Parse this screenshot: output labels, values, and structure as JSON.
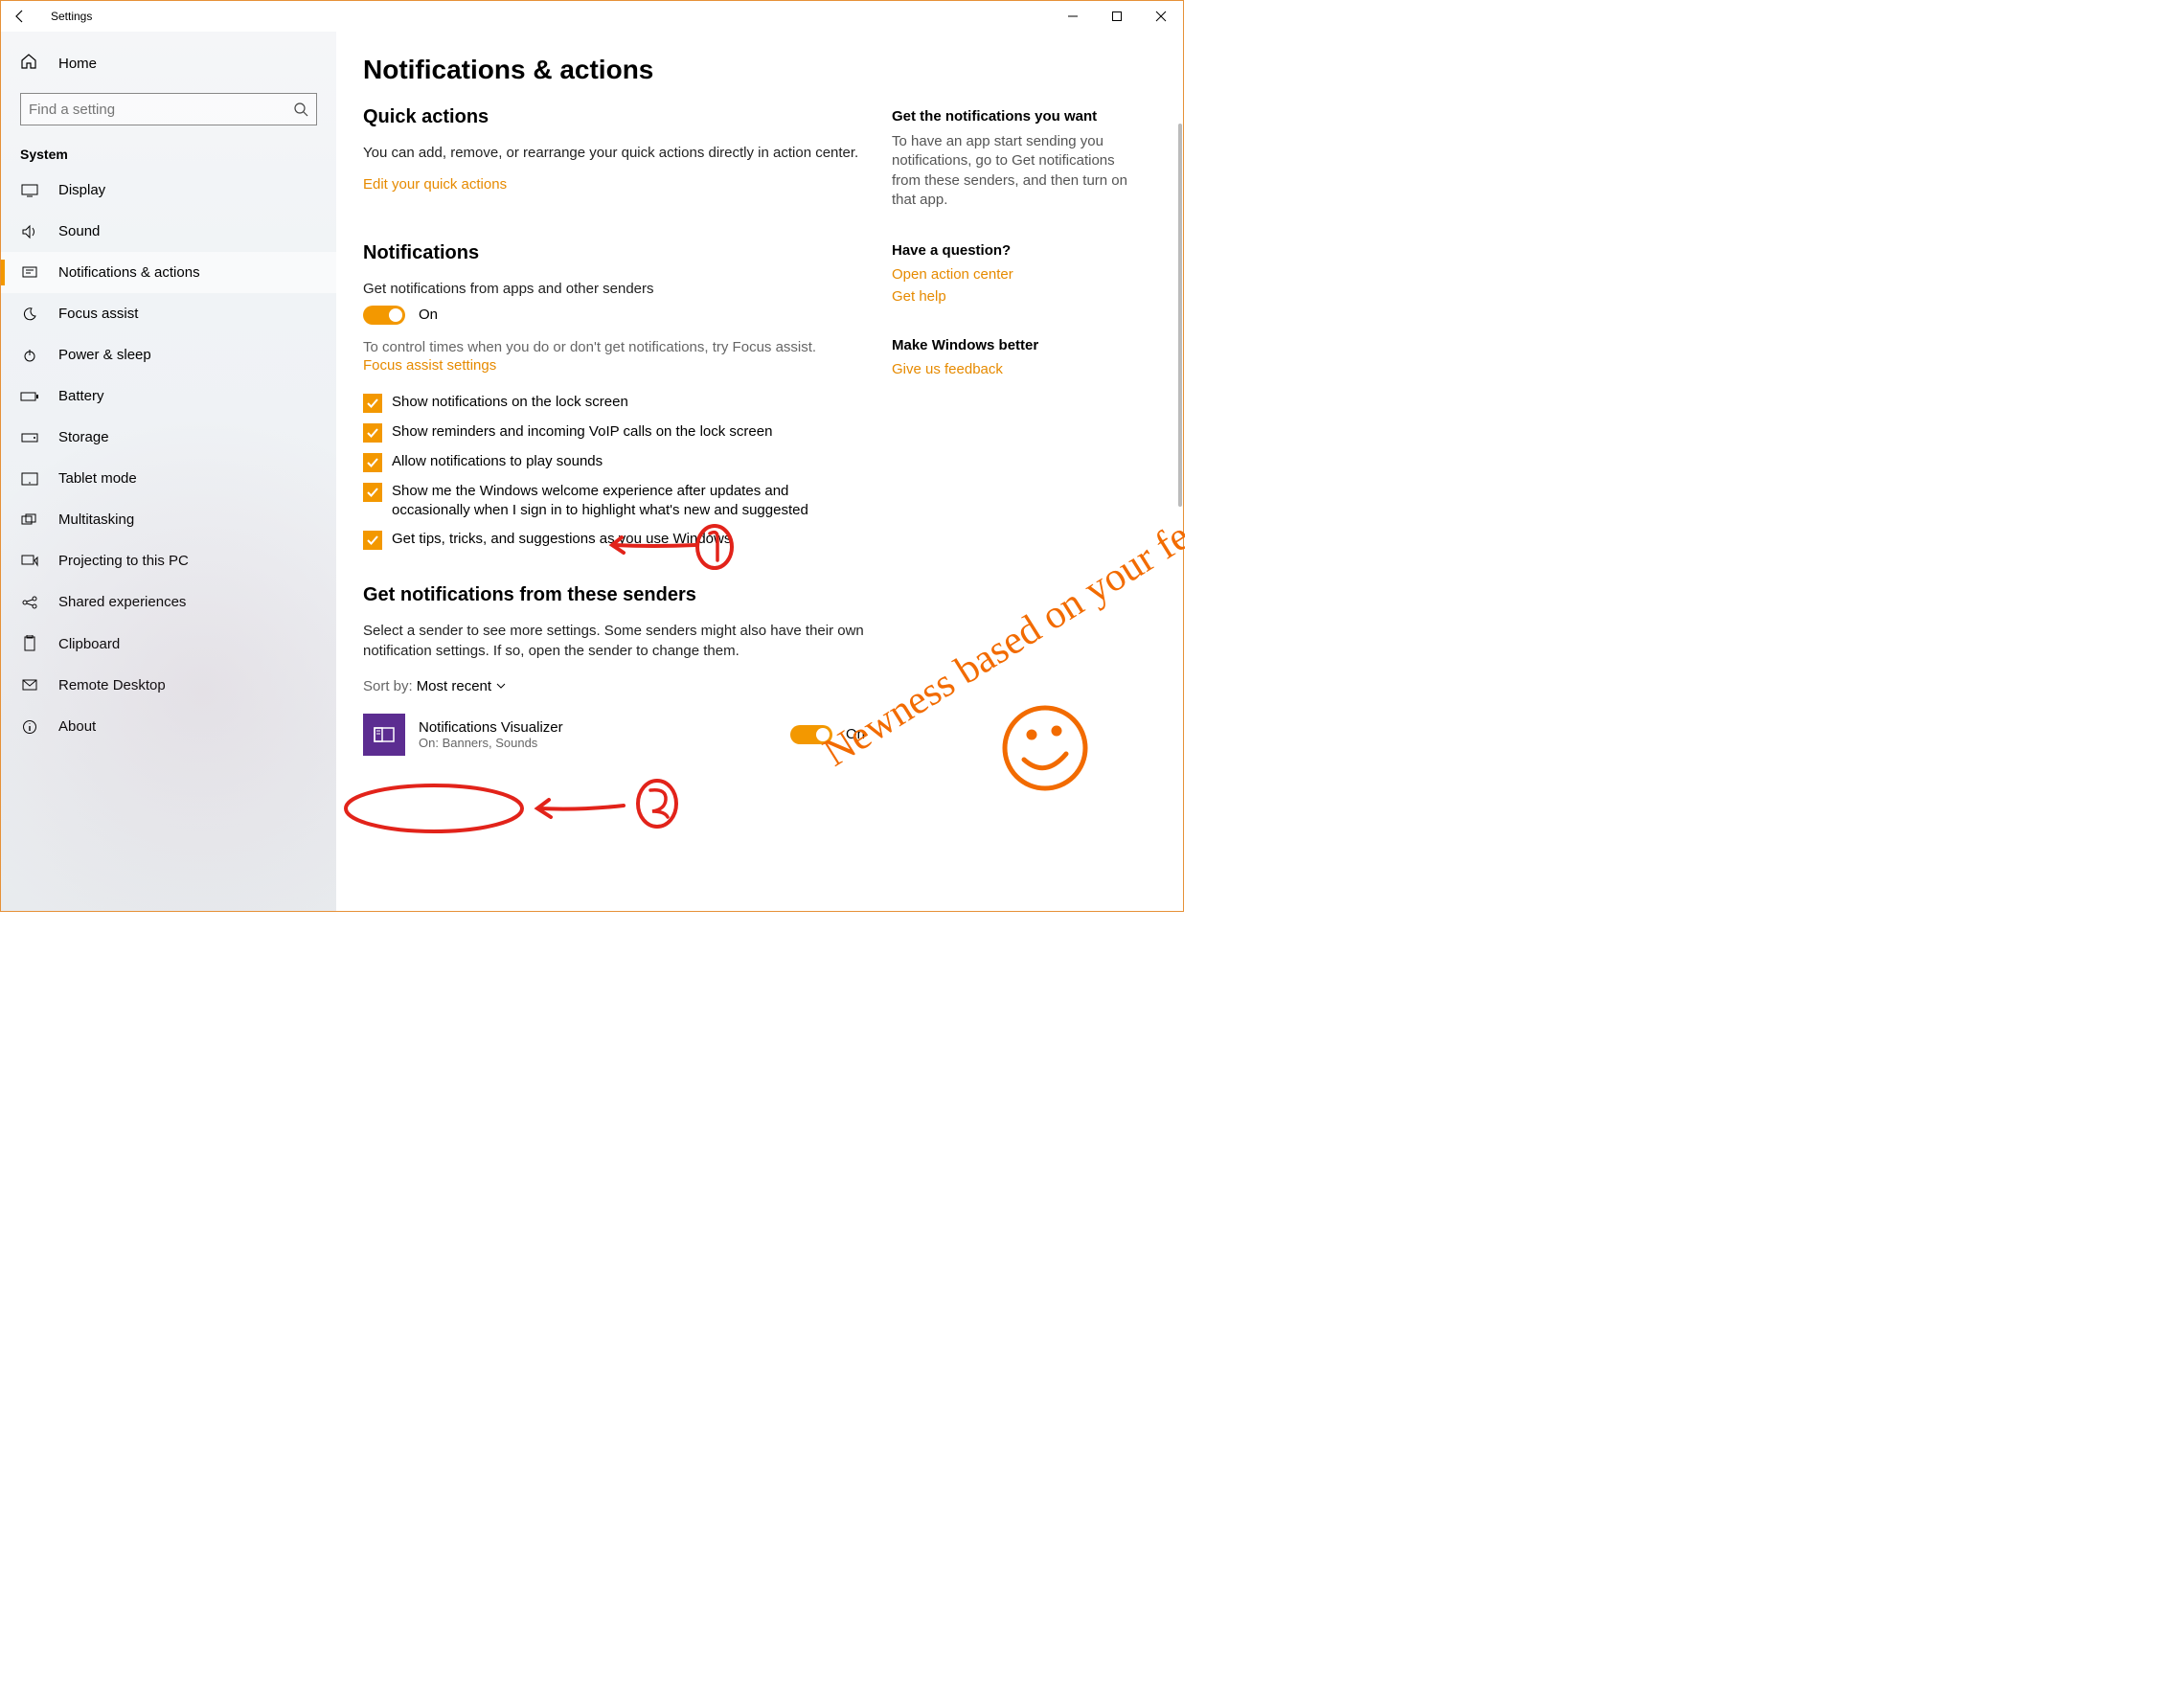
{
  "window": {
    "title": "Settings"
  },
  "sidebar": {
    "home_label": "Home",
    "search_placeholder": "Find a setting",
    "category": "System",
    "items": [
      {
        "label": "Display"
      },
      {
        "label": "Sound"
      },
      {
        "label": "Notifications & actions"
      },
      {
        "label": "Focus assist"
      },
      {
        "label": "Power & sleep"
      },
      {
        "label": "Battery"
      },
      {
        "label": "Storage"
      },
      {
        "label": "Tablet mode"
      },
      {
        "label": "Multitasking"
      },
      {
        "label": "Projecting to this PC"
      },
      {
        "label": "Shared experiences"
      },
      {
        "label": "Clipboard"
      },
      {
        "label": "Remote Desktop"
      },
      {
        "label": "About"
      }
    ]
  },
  "main": {
    "page_title": "Notifications & actions",
    "quick_actions": {
      "heading": "Quick actions",
      "body": "You can add, remove, or rearrange your quick actions directly in action center.",
      "link": "Edit your quick actions"
    },
    "notifications": {
      "heading": "Notifications",
      "toggle_label": "Get notifications from apps and other senders",
      "toggle_state": "On",
      "hint": "To control times when you do or don't get notifications, try Focus assist.",
      "focus_link": "Focus assist settings",
      "checkboxes": [
        "Show notifications on the lock screen",
        "Show reminders and incoming VoIP calls on the lock screen",
        "Allow notifications to play sounds",
        "Show me the Windows welcome experience after updates and occasionally when I sign in to highlight what's new and suggested",
        "Get tips, tricks, and suggestions as you use Windows"
      ]
    },
    "senders": {
      "heading": "Get notifications from these senders",
      "body": "Select a sender to see more settings. Some senders might also have their own notification settings. If so, open the sender to change them.",
      "sort_label": "Sort by:",
      "sort_value": "Most recent",
      "list": [
        {
          "name": "Notifications Visualizer",
          "sub": "On: Banners, Sounds",
          "state": "On"
        }
      ]
    }
  },
  "side": {
    "help": {
      "heading": "Get the notifications you want",
      "body": "To have an app start sending you notifications, go to Get notifications from these senders, and then turn on that app."
    },
    "question": {
      "heading": "Have a question?",
      "link1": "Open action center",
      "link2": "Get help"
    },
    "feedback": {
      "heading": "Make Windows better",
      "link": "Give us feedback"
    }
  },
  "annotations": {
    "side_text": "Newness based on your feedback"
  }
}
